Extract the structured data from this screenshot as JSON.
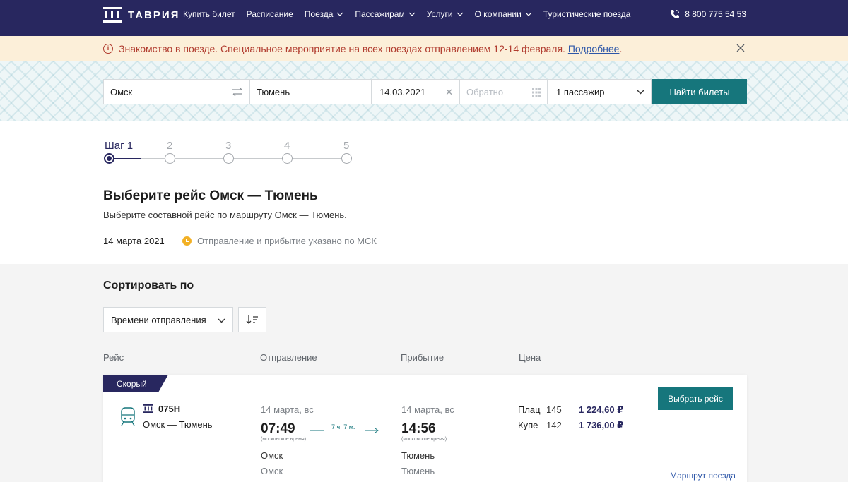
{
  "header": {
    "logo_text": "ТАВРИЯ",
    "nav": [
      {
        "label": "Купить билет",
        "dropdown": false
      },
      {
        "label": "Расписание",
        "dropdown": false
      },
      {
        "label": "Поезда",
        "dropdown": true
      },
      {
        "label": "Пассажирам",
        "dropdown": true
      },
      {
        "label": "Услуги",
        "dropdown": true
      },
      {
        "label": "О компании",
        "dropdown": true
      },
      {
        "label": "Туристические поезда",
        "dropdown": false
      }
    ],
    "phone": "8 800 775 54 53"
  },
  "alert": {
    "text": "Знакомство в поезде. Специальное мероприятие на всех поездах отправлением 12-14 февраля.",
    "link": "Подробнее",
    "link_suffix": "."
  },
  "search": {
    "from": "Омск",
    "to": "Тюмень",
    "date": "14.03.2021",
    "return_placeholder": "Обратно",
    "passengers": "1 пассажир",
    "submit_label": "Найти билеты"
  },
  "steps": {
    "active_label": "Шаг 1",
    "labels": [
      "2",
      "3",
      "4",
      "5"
    ]
  },
  "page": {
    "title": "Выберите рейс Омск — Тюмень",
    "subtitle": "Выберите составной рейс по маршруту Омск — Тюмень.",
    "date": "14 марта 2021",
    "timezone_note": "Отправление и прибытие указано по МСК"
  },
  "sort": {
    "title": "Сортировать по",
    "selected": "Времени отправления"
  },
  "table": {
    "headers": [
      "Рейс",
      "Отправление",
      "Прибытие",
      "Цена"
    ]
  },
  "trip": {
    "badge": "Скорый",
    "number": "075Н",
    "route": "Омск — Тюмень",
    "departure": {
      "date": "14 марта, вс",
      "time": "07:49",
      "tz": "(московское время)",
      "station": "Омск",
      "city": "Омск"
    },
    "duration": "7 ч. 7 м.",
    "arrival": {
      "date": "14 марта, вс",
      "time": "14:56",
      "tz": "(московское время)",
      "station": "Тюмень",
      "city": "Тюмень"
    },
    "prices": [
      {
        "class": "Плац",
        "seats": "145",
        "price": "1 224,60 ₽"
      },
      {
        "class": "Купе",
        "seats": "142",
        "price": "1 736,00 ₽"
      }
    ],
    "choose_label": "Выбрать рейс",
    "route_link": "Маршрут поезда"
  },
  "colors": {
    "header_bg": "#28275f",
    "accent": "#16767c",
    "alert_bg": "#fcefd9",
    "alert_text": "#b13c2f",
    "link": "#2e57a8"
  }
}
